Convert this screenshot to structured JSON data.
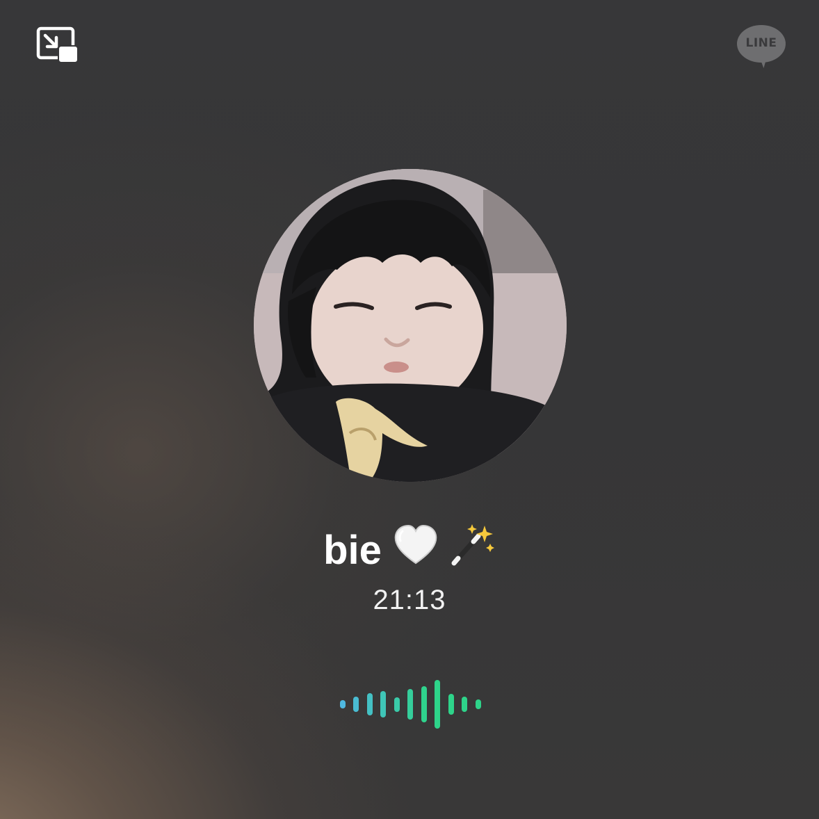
{
  "call": {
    "caller_name": "bie",
    "name_emoji": [
      "heart-icon",
      "magic-wand-sparkles-icon"
    ],
    "duration": "21:13"
  },
  "top_bar": {
    "left_button": "picture-in-picture-icon",
    "right_logo": {
      "text": "LINE",
      "icon": "line-speech-bubble-icon"
    }
  },
  "audio_levels": [
    0.18,
    0.32,
    0.45,
    0.55,
    0.3,
    0.62,
    0.75,
    1.0,
    0.42,
    0.32,
    0.2
  ],
  "colors": {
    "wave_start": "#4fb8e0",
    "wave_end": "#2ed48a",
    "logo_gray": "#6e6e70"
  }
}
